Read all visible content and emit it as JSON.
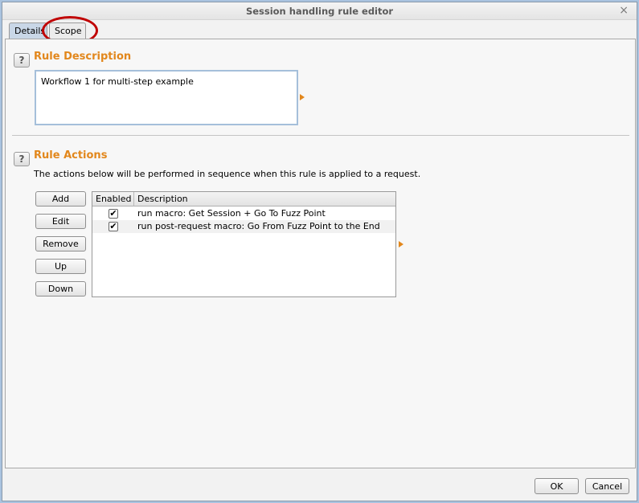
{
  "window": {
    "title": "Session handling rule editor",
    "close_glyph": "×"
  },
  "tabs": [
    {
      "label": "Details",
      "active": true
    },
    {
      "label": "Scope",
      "active": false
    }
  ],
  "rule_description": {
    "help_glyph": "?",
    "heading": "Rule Description",
    "value": "Workflow 1 for multi-step example"
  },
  "rule_actions": {
    "help_glyph": "?",
    "heading": "Rule Actions",
    "info": "The actions below will be performed in sequence when this rule is applied to a request.",
    "buttons": [
      "Add",
      "Edit",
      "Remove",
      "Up",
      "Down"
    ],
    "table": {
      "columns": [
        "Enabled",
        "Description"
      ],
      "rows": [
        {
          "enabled": true,
          "check_glyph": "✔",
          "description": "run macro: Get Session + Go To Fuzz Point"
        },
        {
          "enabled": true,
          "check_glyph": "✔",
          "description": "run post-request macro: Go From Fuzz Point to the End"
        }
      ]
    }
  },
  "footer": {
    "ok_label": "OK",
    "cancel_label": "Cancel"
  },
  "colors": {
    "accent": "#e2871c",
    "annotation": "#c00000",
    "active_tab": "#c9d7e7"
  }
}
